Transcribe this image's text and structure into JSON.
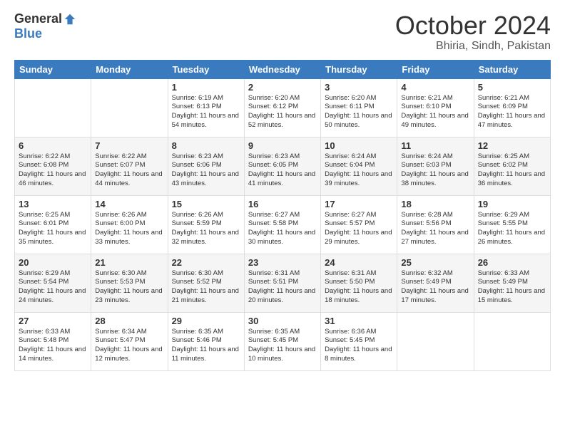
{
  "logo": {
    "general": "General",
    "blue": "Blue"
  },
  "header": {
    "month": "October 2024",
    "location": "Bhiria, Sindh, Pakistan"
  },
  "days_of_week": [
    "Sunday",
    "Monday",
    "Tuesday",
    "Wednesday",
    "Thursday",
    "Friday",
    "Saturday"
  ],
  "weeks": [
    [
      {
        "day": "",
        "info": ""
      },
      {
        "day": "",
        "info": ""
      },
      {
        "day": "1",
        "info": "Sunrise: 6:19 AM\nSunset: 6:13 PM\nDaylight: 11 hours and 54 minutes."
      },
      {
        "day": "2",
        "info": "Sunrise: 6:20 AM\nSunset: 6:12 PM\nDaylight: 11 hours and 52 minutes."
      },
      {
        "day": "3",
        "info": "Sunrise: 6:20 AM\nSunset: 6:11 PM\nDaylight: 11 hours and 50 minutes."
      },
      {
        "day": "4",
        "info": "Sunrise: 6:21 AM\nSunset: 6:10 PM\nDaylight: 11 hours and 49 minutes."
      },
      {
        "day": "5",
        "info": "Sunrise: 6:21 AM\nSunset: 6:09 PM\nDaylight: 11 hours and 47 minutes."
      }
    ],
    [
      {
        "day": "6",
        "info": "Sunrise: 6:22 AM\nSunset: 6:08 PM\nDaylight: 11 hours and 46 minutes."
      },
      {
        "day": "7",
        "info": "Sunrise: 6:22 AM\nSunset: 6:07 PM\nDaylight: 11 hours and 44 minutes."
      },
      {
        "day": "8",
        "info": "Sunrise: 6:23 AM\nSunset: 6:06 PM\nDaylight: 11 hours and 43 minutes."
      },
      {
        "day": "9",
        "info": "Sunrise: 6:23 AM\nSunset: 6:05 PM\nDaylight: 11 hours and 41 minutes."
      },
      {
        "day": "10",
        "info": "Sunrise: 6:24 AM\nSunset: 6:04 PM\nDaylight: 11 hours and 39 minutes."
      },
      {
        "day": "11",
        "info": "Sunrise: 6:24 AM\nSunset: 6:03 PM\nDaylight: 11 hours and 38 minutes."
      },
      {
        "day": "12",
        "info": "Sunrise: 6:25 AM\nSunset: 6:02 PM\nDaylight: 11 hours and 36 minutes."
      }
    ],
    [
      {
        "day": "13",
        "info": "Sunrise: 6:25 AM\nSunset: 6:01 PM\nDaylight: 11 hours and 35 minutes."
      },
      {
        "day": "14",
        "info": "Sunrise: 6:26 AM\nSunset: 6:00 PM\nDaylight: 11 hours and 33 minutes."
      },
      {
        "day": "15",
        "info": "Sunrise: 6:26 AM\nSunset: 5:59 PM\nDaylight: 11 hours and 32 minutes."
      },
      {
        "day": "16",
        "info": "Sunrise: 6:27 AM\nSunset: 5:58 PM\nDaylight: 11 hours and 30 minutes."
      },
      {
        "day": "17",
        "info": "Sunrise: 6:27 AM\nSunset: 5:57 PM\nDaylight: 11 hours and 29 minutes."
      },
      {
        "day": "18",
        "info": "Sunrise: 6:28 AM\nSunset: 5:56 PM\nDaylight: 11 hours and 27 minutes."
      },
      {
        "day": "19",
        "info": "Sunrise: 6:29 AM\nSunset: 5:55 PM\nDaylight: 11 hours and 26 minutes."
      }
    ],
    [
      {
        "day": "20",
        "info": "Sunrise: 6:29 AM\nSunset: 5:54 PM\nDaylight: 11 hours and 24 minutes."
      },
      {
        "day": "21",
        "info": "Sunrise: 6:30 AM\nSunset: 5:53 PM\nDaylight: 11 hours and 23 minutes."
      },
      {
        "day": "22",
        "info": "Sunrise: 6:30 AM\nSunset: 5:52 PM\nDaylight: 11 hours and 21 minutes."
      },
      {
        "day": "23",
        "info": "Sunrise: 6:31 AM\nSunset: 5:51 PM\nDaylight: 11 hours and 20 minutes."
      },
      {
        "day": "24",
        "info": "Sunrise: 6:31 AM\nSunset: 5:50 PM\nDaylight: 11 hours and 18 minutes."
      },
      {
        "day": "25",
        "info": "Sunrise: 6:32 AM\nSunset: 5:49 PM\nDaylight: 11 hours and 17 minutes."
      },
      {
        "day": "26",
        "info": "Sunrise: 6:33 AM\nSunset: 5:49 PM\nDaylight: 11 hours and 15 minutes."
      }
    ],
    [
      {
        "day": "27",
        "info": "Sunrise: 6:33 AM\nSunset: 5:48 PM\nDaylight: 11 hours and 14 minutes."
      },
      {
        "day": "28",
        "info": "Sunrise: 6:34 AM\nSunset: 5:47 PM\nDaylight: 11 hours and 12 minutes."
      },
      {
        "day": "29",
        "info": "Sunrise: 6:35 AM\nSunset: 5:46 PM\nDaylight: 11 hours and 11 minutes."
      },
      {
        "day": "30",
        "info": "Sunrise: 6:35 AM\nSunset: 5:45 PM\nDaylight: 11 hours and 10 minutes."
      },
      {
        "day": "31",
        "info": "Sunrise: 6:36 AM\nSunset: 5:45 PM\nDaylight: 11 hours and 8 minutes."
      },
      {
        "day": "",
        "info": ""
      },
      {
        "day": "",
        "info": ""
      }
    ]
  ]
}
